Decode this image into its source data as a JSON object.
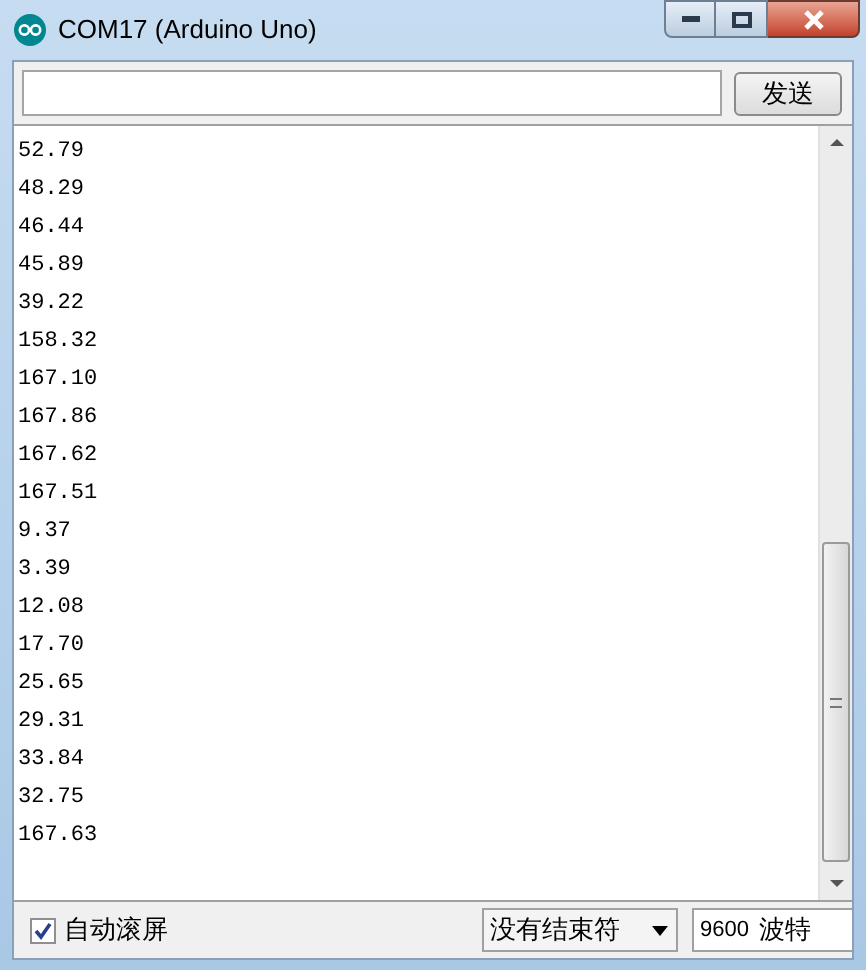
{
  "window": {
    "title": "COM17 (Arduino Uno)"
  },
  "send_button": {
    "label": "发送"
  },
  "output_lines": [
    "52.79",
    "48.29",
    "46.44",
    "45.89",
    "39.22",
    "158.32",
    "167.10",
    "167.86",
    "167.62",
    "167.51",
    "9.37",
    "3.39",
    "12.08",
    "17.70",
    "25.65",
    "29.31",
    "33.84",
    "32.75",
    "167.63"
  ],
  "autoscroll": {
    "label": "自动滚屏",
    "checked": true
  },
  "line_ending": {
    "value": "没有结束符"
  },
  "baud_rate": {
    "value": "9600",
    "unit": "波特"
  }
}
